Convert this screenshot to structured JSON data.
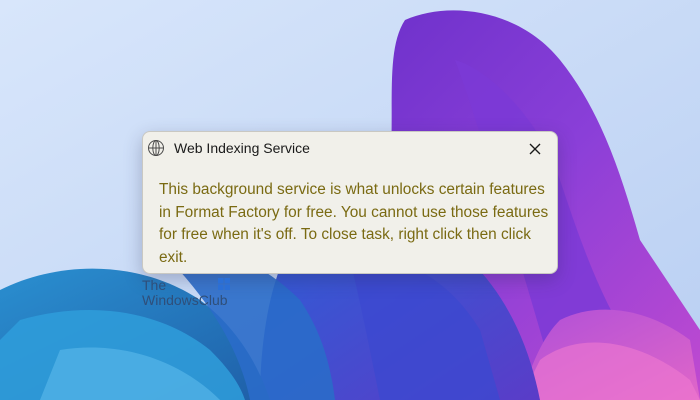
{
  "dialog": {
    "title": "Web Indexing Service",
    "message": "This background service is what unlocks certain features in Format Factory for free. You cannot use those features for free when it's off. To close task, right click then click exit.",
    "icons": {
      "app": "globe-icon",
      "close": "close-icon"
    }
  },
  "watermark": {
    "line1": "The",
    "line2": "WindowsClub"
  },
  "colors": {
    "desktop_background": "#c9dcf7",
    "dialog_background": "#f1f0ea",
    "message_text": "#7a6a12",
    "title_text": "#1a1a1a"
  }
}
